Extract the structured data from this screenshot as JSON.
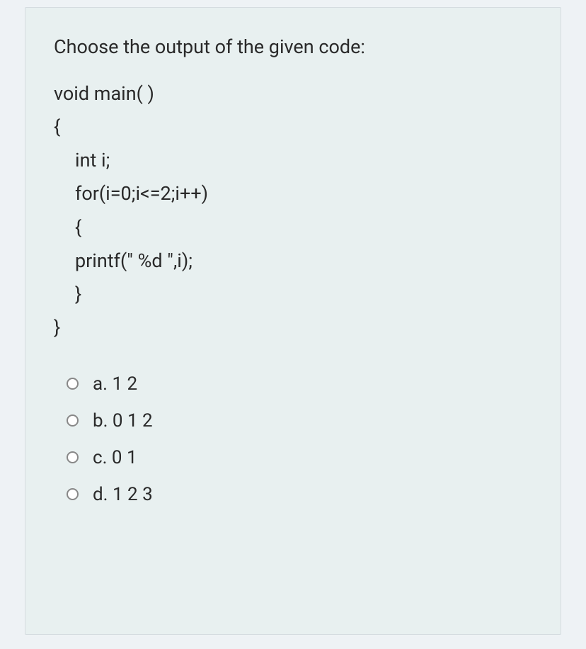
{
  "question": {
    "prompt": "Choose the output of the given code:",
    "code": {
      "line1": "void main( )",
      "line2": "{",
      "line3": "int i;",
      "line4": "for(i=0;i<=2;i++)",
      "line5": "{",
      "line6": "printf(\" %d \",i);",
      "line7": "}",
      "line8": "}"
    },
    "options": [
      {
        "label": "a. 1 2"
      },
      {
        "label": "b. 0 1 2"
      },
      {
        "label": "c. 0 1"
      },
      {
        "label": "d. 1 2 3"
      }
    ]
  }
}
